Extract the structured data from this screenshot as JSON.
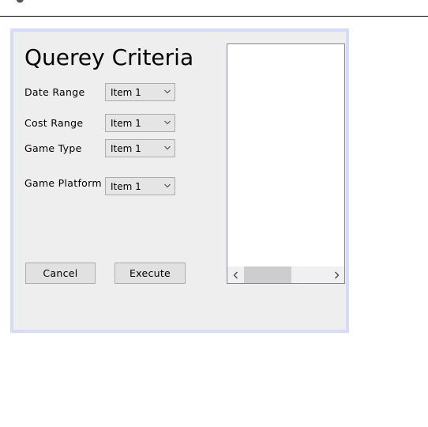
{
  "dialog": {
    "title": "Querey Criteria",
    "fields": [
      {
        "label": "Date Range",
        "value": "Item 1"
      },
      {
        "label": "Cost Range",
        "value": "Item 1"
      },
      {
        "label": "Game Type",
        "value": "Item 1"
      },
      {
        "label": "Game Platform",
        "value": "Item 1"
      }
    ],
    "buttons": {
      "cancel": "Cancel",
      "execute": "Execute"
    },
    "results_list": {
      "scroll_left_icon": "chevron-left-icon",
      "scroll_right_icon": "chevron-right-icon"
    }
  },
  "colors": {
    "dialog_border": "#d6dcf8",
    "dialog_background": "#eeeeee",
    "button_background": "#e1e1e1",
    "combo_background": "#e5e5e5",
    "list_background": "#ffffff"
  }
}
